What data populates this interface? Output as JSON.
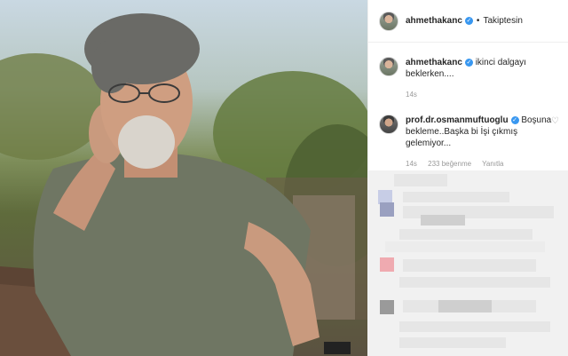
{
  "post": {
    "author": "ahmethakanc",
    "follow_label": "Takiptesin",
    "dot": "•"
  },
  "caption": {
    "author": "ahmethakanc",
    "text": "ikinci dalgayı beklerken....",
    "time": "14s"
  },
  "comments": [
    {
      "author": "prof.dr.osmanmuftuoglu",
      "text": "Boşuna bekleme..Başka bi İşi çıkmış gelemiyor...",
      "time": "14s",
      "likes": "233 beğenme",
      "reply_label": "Yanıtla"
    }
  ],
  "icons": {
    "verified": "verified-badge-icon",
    "heart": "heart-icon"
  },
  "colors": {
    "verified_blue": "#3897f0",
    "meta_gray": "#999999"
  }
}
